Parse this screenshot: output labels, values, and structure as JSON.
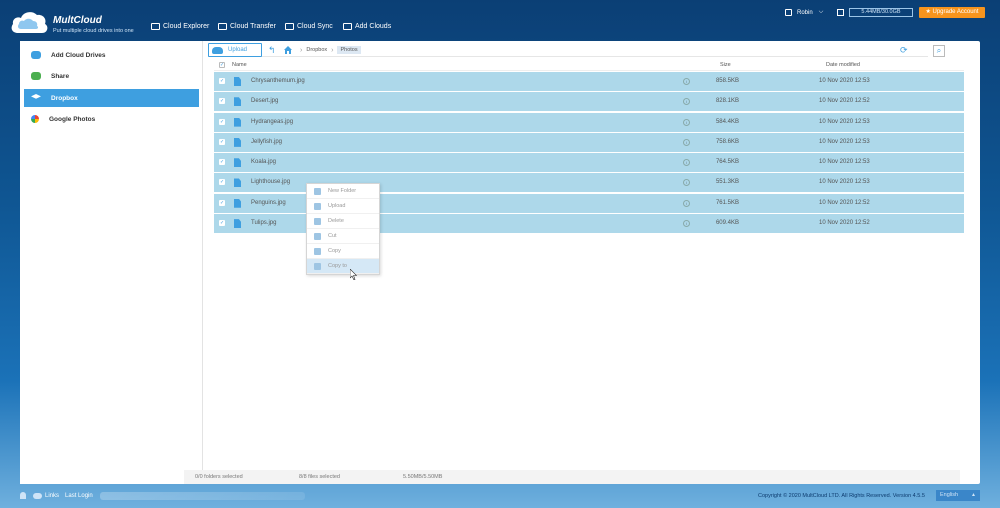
{
  "header": {
    "brand": "MultCloud",
    "tagline": "Put multiple cloud drives into one",
    "nav": [
      {
        "label": "Cloud Explorer",
        "icon": "explorer-icon"
      },
      {
        "label": "Cloud Transfer",
        "icon": "transfer-icon"
      },
      {
        "label": "Cloud Sync",
        "icon": "sync-icon"
      },
      {
        "label": "Add Clouds",
        "icon": "add-icon"
      }
    ],
    "username": "Robin",
    "quota": "5.44MB/30.0GB",
    "upgrade_label": "★ Upgrade Account"
  },
  "sidebar": {
    "items": [
      {
        "label": "Add Cloud Drives",
        "icon": "cloud-add-icon",
        "active": false
      },
      {
        "label": "Share",
        "icon": "share-icon",
        "active": false
      },
      {
        "label": "Dropbox",
        "icon": "dropbox-icon",
        "active": true
      },
      {
        "label": "Google Photos",
        "icon": "google-photos-icon",
        "active": false
      }
    ]
  },
  "toolbar": {
    "upload_label": "Upload",
    "breadcrumb": [
      "Dropbox",
      "Photos"
    ]
  },
  "table": {
    "headers": {
      "name": "Name",
      "size": "Size",
      "date": "Date modified"
    },
    "rows": [
      {
        "name": "Chrysanthemum.jpg",
        "size": "858.5KB",
        "date": "10 Nov 2020 12:53"
      },
      {
        "name": "Desert.jpg",
        "size": "828.1KB",
        "date": "10 Nov 2020 12:52"
      },
      {
        "name": "Hydrangeas.jpg",
        "size": "584.4KB",
        "date": "10 Nov 2020 12:53"
      },
      {
        "name": "Jellyfish.jpg",
        "size": "758.6KB",
        "date": "10 Nov 2020 12:53"
      },
      {
        "name": "Koala.jpg",
        "size": "764.5KB",
        "date": "10 Nov 2020 12:53"
      },
      {
        "name": "Lighthouse.jpg",
        "size": "551.3KB",
        "date": "10 Nov 2020 12:53"
      },
      {
        "name": "Penguins.jpg",
        "size": "761.5KB",
        "date": "10 Nov 2020 12:52"
      },
      {
        "name": "Tulips.jpg",
        "size": "609.4KB",
        "date": "10 Nov 2020 12:52"
      }
    ]
  },
  "context_menu": {
    "items": [
      {
        "label": "New Folder",
        "icon": "new-folder-icon"
      },
      {
        "label": "Upload",
        "icon": "upload-icon"
      },
      {
        "label": "Delete",
        "icon": "delete-icon"
      },
      {
        "label": "Cut",
        "icon": "cut-icon"
      },
      {
        "label": "Copy",
        "icon": "copy-icon"
      },
      {
        "label": "Copy to",
        "icon": "copy-to-icon"
      }
    ]
  },
  "status": {
    "folders": "0/0 folders selected",
    "files": "8/8 files selected",
    "size": "5.50MB/5.50MB"
  },
  "footer": {
    "links_label": "Links",
    "last_login_label": "Last Login",
    "copyright": "Copyright © 2020 MultCloud LTD. All Rights Reserved. Version 4.5.5",
    "language": "English"
  }
}
